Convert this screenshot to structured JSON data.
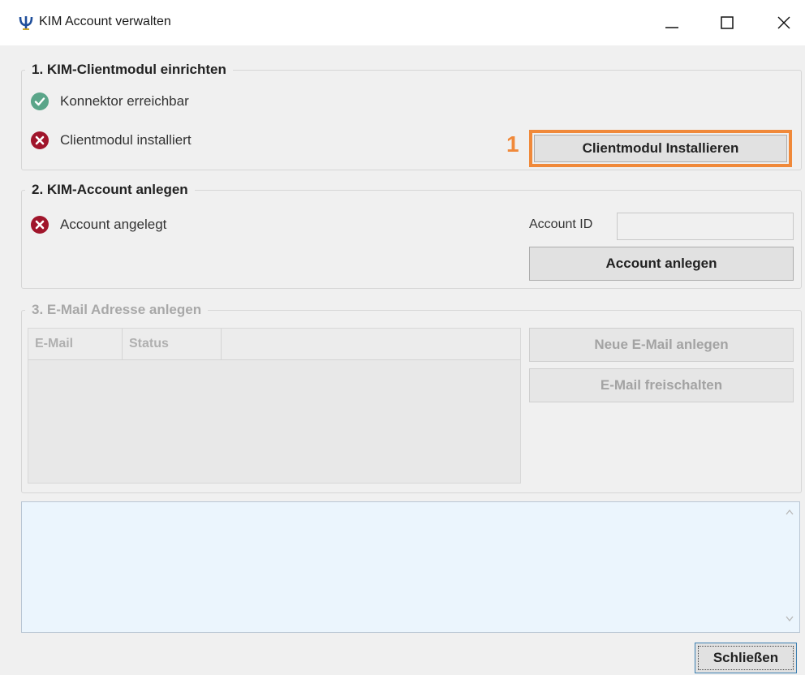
{
  "window": {
    "title": "KIM Account verwalten",
    "icon": "psi-icon",
    "controls": [
      "minimize-icon",
      "maximize-icon",
      "close-icon"
    ]
  },
  "section1": {
    "title": "1. KIM-Clientmodul einrichten",
    "items": [
      {
        "label": "Konnektor erreichbar",
        "status": "ok",
        "icon": "check-circle-icon"
      },
      {
        "label": "Clientmodul installiert",
        "status": "error",
        "icon": "error-circle-icon"
      }
    ],
    "install_button": "Clientmodul Installieren",
    "step_marker": "1"
  },
  "section2": {
    "title": "2. KIM-Account anlegen",
    "items": [
      {
        "label": "Account angelegt",
        "status": "error",
        "icon": "error-circle-icon"
      }
    ],
    "account_id_label": "Account ID",
    "account_id_value": "",
    "create_button": "Account anlegen"
  },
  "section3": {
    "title": "3. E-Mail Adresse anlegen",
    "columns": [
      "E-Mail",
      "Status",
      ""
    ],
    "rows": [],
    "new_email_button": "Neue E-Mail anlegen",
    "activate_button": "E-Mail freischalten"
  },
  "log": {
    "text": ""
  },
  "footer": {
    "close_button": "Schließen"
  },
  "colors": {
    "accent_highlight": "#f0893a",
    "ok": "#5aa589",
    "error": "#a0152b",
    "log_bg": "#ebf5fd"
  }
}
